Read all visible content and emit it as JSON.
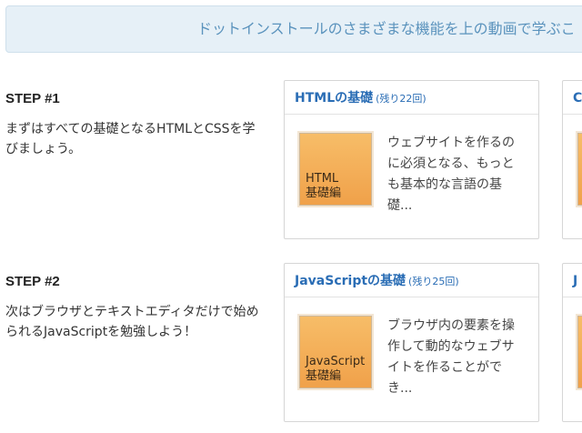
{
  "notice": {
    "text": "ドットインストールのさまざまな機能を上の動画で学ぶこ"
  },
  "steps": [
    {
      "title": "STEP #1",
      "description": "まずはすべての基礎となるHTMLとCSSを学びましょう。",
      "card": {
        "title": "HTMLの基礎",
        "count": "(残り22回)",
        "thumb_text": "HTML\n基礎編",
        "description": "ウェブサイトを作るのに必須となる、もっとも基本的な言語の基礎..."
      },
      "partial_card": {
        "title_initial": "C"
      }
    },
    {
      "title": "STEP #2",
      "description": "次はブラウザとテキストエディタだけで始められるJavaScriptを勉強しよう！",
      "card": {
        "title": "JavaScriptの基礎",
        "count": "(残り25回)",
        "thumb_text": "JavaScript\n基礎編",
        "description": "ブラウザ内の要素を操作して動的なウェブサイトを作ることができ..."
      },
      "partial_card": {
        "title_initial": "J"
      }
    }
  ],
  "colors": {
    "link": "#2a6db5",
    "notice_bg": "#e6f0f7",
    "notice_text": "#5b93bd",
    "thumb": "#f0a14a"
  }
}
